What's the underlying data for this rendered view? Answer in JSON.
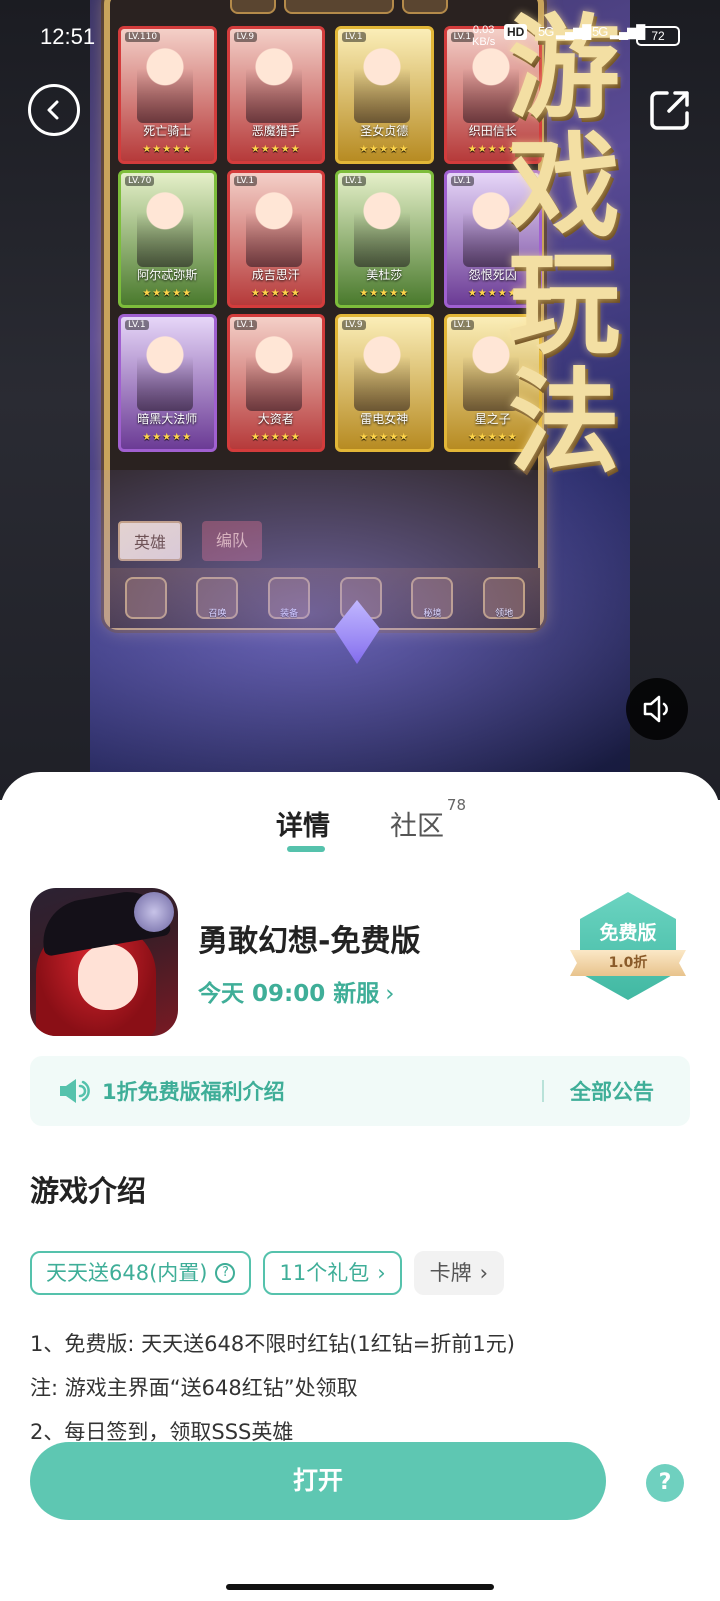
{
  "status_bar": {
    "time": "12:51",
    "net_speed_value": "0.03",
    "net_speed_unit": "KB/s",
    "hd_label": "HD",
    "sig1": "5G",
    "sig2": "5G",
    "battery": "72"
  },
  "media": {
    "overlay_title_chars": [
      "游",
      "戏",
      "玩",
      "法"
    ],
    "game_heroes": [
      {
        "name": "死亡骑士",
        "lv": "LV.110",
        "stars": "★★★★★",
        "color": "r"
      },
      {
        "name": "恶魔猎手",
        "lv": "LV.9",
        "stars": "★★★★★",
        "color": "r"
      },
      {
        "name": "圣女贞德",
        "lv": "LV.1",
        "stars": "★★★★★",
        "color": "y"
      },
      {
        "name": "织田信长",
        "lv": "LV.1",
        "stars": "★★★★★",
        "color": "r"
      },
      {
        "name": "阿尔忒弥斯",
        "lv": "LV.70",
        "stars": "★★★★★",
        "color": "g"
      },
      {
        "name": "成吉思汗",
        "lv": "LV.1",
        "stars": "★★★★★",
        "color": "r"
      },
      {
        "name": "美杜莎",
        "lv": "LV.1",
        "stars": "★★★★★",
        "color": "g"
      },
      {
        "name": "怨恨死囚",
        "lv": "LV.1",
        "stars": "★★★★★",
        "color": "p"
      },
      {
        "name": "暗黑大法师",
        "lv": "LV.1",
        "stars": "★★★★★",
        "color": "p"
      },
      {
        "name": "大资者",
        "lv": "LV.1",
        "stars": "★★★★★",
        "color": "r"
      },
      {
        "name": "雷电女神",
        "lv": "LV.9",
        "stars": "★★★★★",
        "color": "y"
      },
      {
        "name": "星之子",
        "lv": "LV.1",
        "stars": "★★★★★",
        "color": "y"
      }
    ],
    "game_tabs": [
      "英雄",
      "编队"
    ],
    "dock_items": [
      "",
      "召唤",
      "装备",
      "",
      "秘境",
      "领地"
    ]
  },
  "tabs": {
    "details": "详情",
    "community": "社区",
    "community_count": "78"
  },
  "app": {
    "name": "勇敢幻想-免费版",
    "server_info": "今天 09:00 新服",
    "badge_title": "免费版",
    "badge_discount": "1.0折"
  },
  "notice": {
    "text": "1折免费版福利介绍",
    "all_label": "全部公告"
  },
  "intro": {
    "title": "游戏介绍",
    "chips": [
      {
        "label": "天天送648(内置)",
        "icon": "question-circle-icon"
      },
      {
        "label": "11个礼包",
        "icon": "chevron-right-icon"
      },
      {
        "label": "卡牌",
        "icon": "chevron-right-icon"
      }
    ],
    "lines": [
      "1、免费版: 天天送648不限时红钻(1红钻=折前1元)",
      "注: 游戏主界面“送648红钻”处领取",
      "2、每日签到，领取SSS英雄"
    ]
  },
  "actions": {
    "open": "打开",
    "help": "?"
  },
  "colors": {
    "accent": "#55c2ac",
    "accent_text": "#3fae98",
    "button": "#5ec7b2"
  }
}
